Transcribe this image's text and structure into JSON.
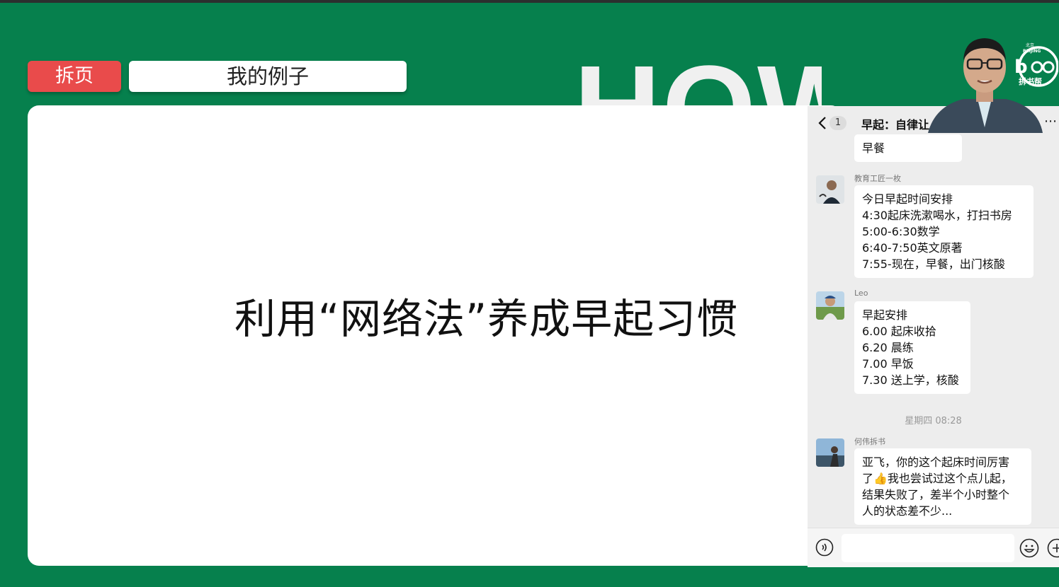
{
  "page": {
    "tab_label": "拆页",
    "section_title": "我的例子",
    "background_word": "HOW",
    "slide_title": "利用“网络法”养成早起习惯"
  },
  "chat": {
    "back_count": "1",
    "title": "早起：自律让",
    "more_icon": "more-icon",
    "messages": [
      {
        "sender": "",
        "lines": [
          "早餐"
        ]
      },
      {
        "sender": "教育工匠一枚",
        "lines": [
          "今日早起时间安排",
          "4:30起床洗漱喝水，打扫书房",
          "5:00-6:30数学",
          "6:40-7:50英文原著",
          "7:55-现在，早餐，出门核酸"
        ]
      },
      {
        "sender": "Leo",
        "lines": [
          "早起安排",
          "6.00 起床收拾",
          "6.20 晨练",
          "7.00 早饭",
          "7.30 送上学，核酸"
        ]
      },
      {
        "sender": "何伟拆书",
        "lines": [
          "亚飞，你的这个起床时间厉害",
          "了👍我也尝试过这个点儿起，",
          "结果失败了，差半个小时整个",
          "人的状态差不少..."
        ]
      }
    ],
    "timestamp": "星期四 08:28",
    "input_placeholder": ""
  },
  "logo": {
    "city_cn": "北京",
    "city_en": "BEIJING",
    "brand": "拆书帮"
  },
  "colors": {
    "background": "#06804d",
    "tab_red": "#e94b4b",
    "chat_bg": "#ededed"
  }
}
